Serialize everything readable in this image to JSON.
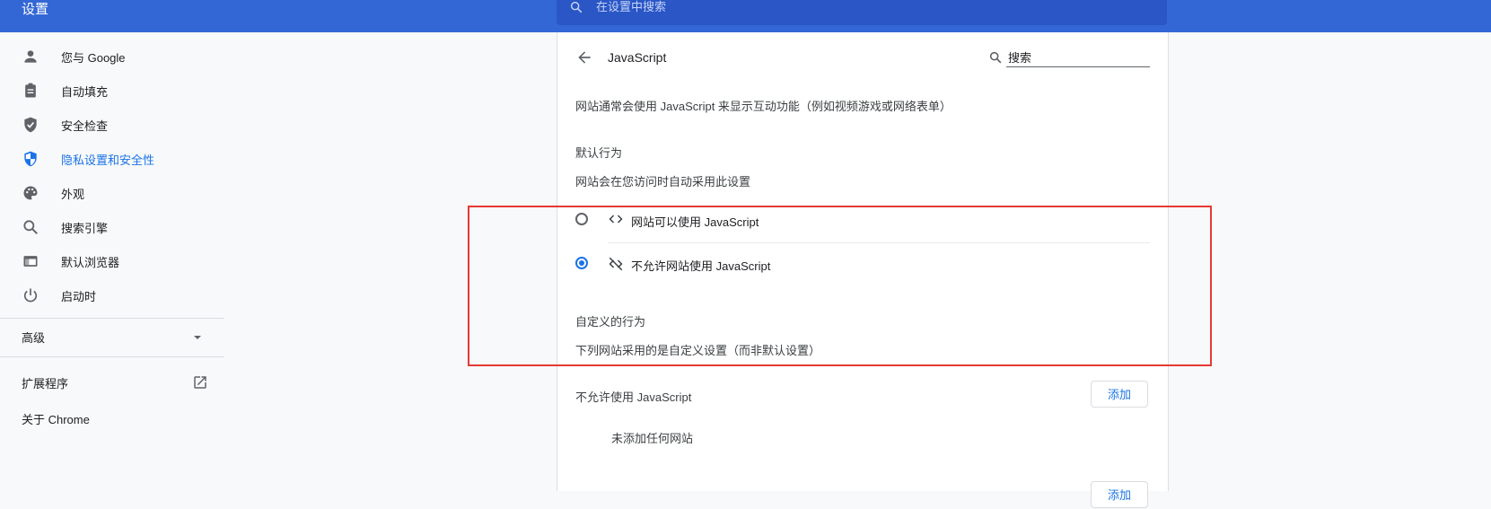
{
  "header": {
    "title": "设置",
    "search_placeholder": "在设置中搜索"
  },
  "sidebar": {
    "items": [
      {
        "label": "您与 Google",
        "icon": "person-icon"
      },
      {
        "label": "自动填充",
        "icon": "clipboard-icon"
      },
      {
        "label": "安全检查",
        "icon": "shield-check-icon"
      },
      {
        "label": "隐私设置和安全性",
        "icon": "shield-privacy-icon",
        "active": true
      },
      {
        "label": "外观",
        "icon": "palette-icon"
      },
      {
        "label": "搜索引擎",
        "icon": "search-icon"
      },
      {
        "label": "默认浏览器",
        "icon": "browser-icon"
      },
      {
        "label": "启动时",
        "icon": "power-icon"
      }
    ],
    "advanced_label": "高级",
    "extensions_label": "扩展程序",
    "about_label": "关于 Chrome"
  },
  "content": {
    "title": "JavaScript",
    "search_value": "搜索",
    "description": "网站通常会使用 JavaScript 来显示互动功能（例如视频游戏或网络表单）",
    "default_heading": "默认行为",
    "default_sub": "网站会在您访问时自动采用此设置",
    "options": [
      {
        "label": "网站可以使用 JavaScript",
        "icon": "code-icon",
        "selected": false
      },
      {
        "label": "不允许网站使用 JavaScript",
        "icon": "code-off-icon",
        "selected": true
      }
    ],
    "custom_heading": "自定义的行为",
    "custom_sub": "下列网站采用的是自定义设置（而非默认设置）",
    "block_heading": "不允许使用 JavaScript",
    "add_label": "添加",
    "empty_text": "未添加任何网站",
    "add_label_2": "添加"
  },
  "colors": {
    "header": "#3367d6",
    "accent": "#1a73e8",
    "highlight_border": "#e53935"
  }
}
